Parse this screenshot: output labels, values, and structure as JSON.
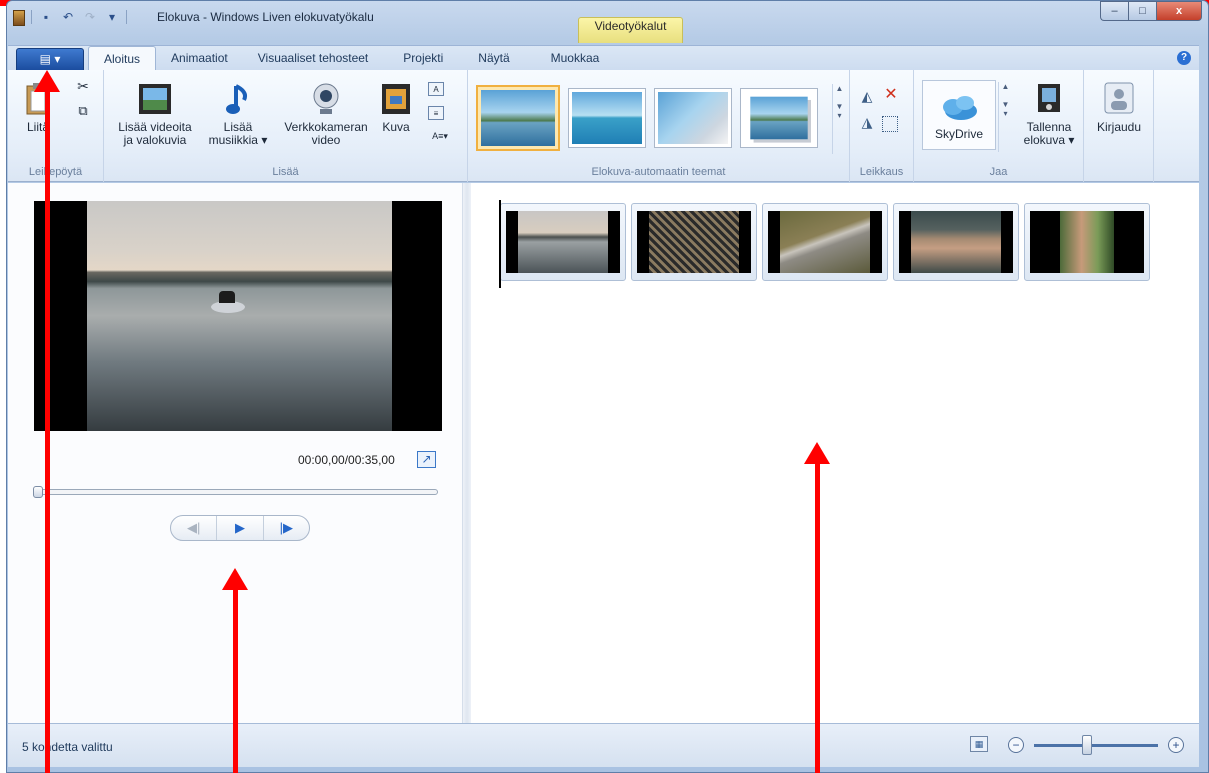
{
  "window": {
    "title": "Elokuva - Windows Liven elokuvatyökalu",
    "contextual_tab_group": "Videotyökalut",
    "min_glyph": "–",
    "max_glyph": "□",
    "close_glyph": "x"
  },
  "qat": {
    "save": "▪",
    "undo": "↶",
    "redo": "↷",
    "more": "▾"
  },
  "app_menu_label": "▤ ▾",
  "help_label": "?",
  "tabs": [
    "Aloitus",
    "Animaatiot",
    "Visuaaliset tehosteet",
    "Projekti",
    "Näytä",
    "Muokkaa"
  ],
  "ribbon": {
    "clipboard": {
      "label": "Leikepöytä",
      "paste": "Liitä"
    },
    "add": {
      "label": "Lisää",
      "videos_line1": "Lisää videoita",
      "videos_line2": "ja valokuvia",
      "music_line1": "Lisää",
      "music_line2": "musiikkia ▾",
      "webcam_line1": "Verkkokameran",
      "webcam_line2": "video",
      "snapshot": "Kuva"
    },
    "themes": {
      "label": "Elokuva-automaatin teemat"
    },
    "edit": {
      "label": "Leikkaus"
    },
    "share": {
      "label": "Jaa",
      "skydrive": "SkyDrive",
      "save_line1": "Tallenna",
      "save_line2": "elokuva ▾",
      "signin": "Kirjaudu"
    }
  },
  "preview": {
    "time": "00:00,00/00:35,00",
    "controls": {
      "prev": "◀|",
      "play": "▶",
      "next": "|▶"
    }
  },
  "status": {
    "text": "5 kohdetta valittu",
    "zoom_out": "−",
    "zoom_in": "+"
  },
  "colors": {
    "annotation": "#ff0000",
    "accent": "#2466c9",
    "theme_selected": "#f0b040"
  },
  "icons": [
    "app-icon",
    "save-icon",
    "undo-icon",
    "redo-icon",
    "help-icon",
    "paste-icon",
    "cut-icon",
    "copy-icon",
    "add-video-icon",
    "music-note-icon",
    "webcam-icon",
    "snapshot-icon",
    "rotate-left-icon",
    "remove-icon",
    "rotate-right-icon",
    "select-all-icon",
    "skydrive-icon",
    "save-movie-icon",
    "signin-icon",
    "fullscreen-icon",
    "storyboard-size-icon",
    "zoom-out-icon",
    "zoom-in-icon"
  ]
}
